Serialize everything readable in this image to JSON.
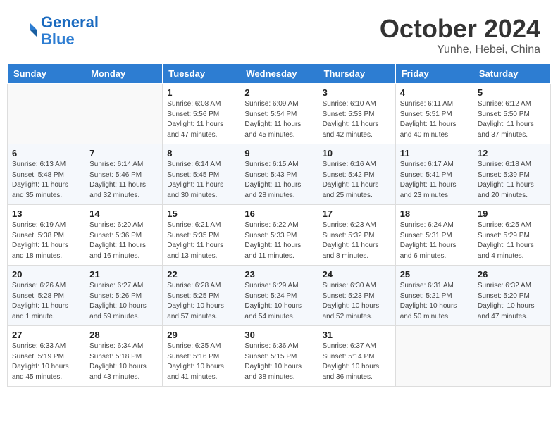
{
  "header": {
    "logo_line1": "General",
    "logo_line2": "Blue",
    "month": "October 2024",
    "location": "Yunhe, Hebei, China"
  },
  "weekdays": [
    "Sunday",
    "Monday",
    "Tuesday",
    "Wednesday",
    "Thursday",
    "Friday",
    "Saturday"
  ],
  "weeks": [
    [
      {
        "day": "",
        "info": ""
      },
      {
        "day": "",
        "info": ""
      },
      {
        "day": "1",
        "info": "Sunrise: 6:08 AM\nSunset: 5:56 PM\nDaylight: 11 hours and 47 minutes."
      },
      {
        "day": "2",
        "info": "Sunrise: 6:09 AM\nSunset: 5:54 PM\nDaylight: 11 hours and 45 minutes."
      },
      {
        "day": "3",
        "info": "Sunrise: 6:10 AM\nSunset: 5:53 PM\nDaylight: 11 hours and 42 minutes."
      },
      {
        "day": "4",
        "info": "Sunrise: 6:11 AM\nSunset: 5:51 PM\nDaylight: 11 hours and 40 minutes."
      },
      {
        "day": "5",
        "info": "Sunrise: 6:12 AM\nSunset: 5:50 PM\nDaylight: 11 hours and 37 minutes."
      }
    ],
    [
      {
        "day": "6",
        "info": "Sunrise: 6:13 AM\nSunset: 5:48 PM\nDaylight: 11 hours and 35 minutes."
      },
      {
        "day": "7",
        "info": "Sunrise: 6:14 AM\nSunset: 5:46 PM\nDaylight: 11 hours and 32 minutes."
      },
      {
        "day": "8",
        "info": "Sunrise: 6:14 AM\nSunset: 5:45 PM\nDaylight: 11 hours and 30 minutes."
      },
      {
        "day": "9",
        "info": "Sunrise: 6:15 AM\nSunset: 5:43 PM\nDaylight: 11 hours and 28 minutes."
      },
      {
        "day": "10",
        "info": "Sunrise: 6:16 AM\nSunset: 5:42 PM\nDaylight: 11 hours and 25 minutes."
      },
      {
        "day": "11",
        "info": "Sunrise: 6:17 AM\nSunset: 5:41 PM\nDaylight: 11 hours and 23 minutes."
      },
      {
        "day": "12",
        "info": "Sunrise: 6:18 AM\nSunset: 5:39 PM\nDaylight: 11 hours and 20 minutes."
      }
    ],
    [
      {
        "day": "13",
        "info": "Sunrise: 6:19 AM\nSunset: 5:38 PM\nDaylight: 11 hours and 18 minutes."
      },
      {
        "day": "14",
        "info": "Sunrise: 6:20 AM\nSunset: 5:36 PM\nDaylight: 11 hours and 16 minutes."
      },
      {
        "day": "15",
        "info": "Sunrise: 6:21 AM\nSunset: 5:35 PM\nDaylight: 11 hours and 13 minutes."
      },
      {
        "day": "16",
        "info": "Sunrise: 6:22 AM\nSunset: 5:33 PM\nDaylight: 11 hours and 11 minutes."
      },
      {
        "day": "17",
        "info": "Sunrise: 6:23 AM\nSunset: 5:32 PM\nDaylight: 11 hours and 8 minutes."
      },
      {
        "day": "18",
        "info": "Sunrise: 6:24 AM\nSunset: 5:31 PM\nDaylight: 11 hours and 6 minutes."
      },
      {
        "day": "19",
        "info": "Sunrise: 6:25 AM\nSunset: 5:29 PM\nDaylight: 11 hours and 4 minutes."
      }
    ],
    [
      {
        "day": "20",
        "info": "Sunrise: 6:26 AM\nSunset: 5:28 PM\nDaylight: 11 hours and 1 minute."
      },
      {
        "day": "21",
        "info": "Sunrise: 6:27 AM\nSunset: 5:26 PM\nDaylight: 10 hours and 59 minutes."
      },
      {
        "day": "22",
        "info": "Sunrise: 6:28 AM\nSunset: 5:25 PM\nDaylight: 10 hours and 57 minutes."
      },
      {
        "day": "23",
        "info": "Sunrise: 6:29 AM\nSunset: 5:24 PM\nDaylight: 10 hours and 54 minutes."
      },
      {
        "day": "24",
        "info": "Sunrise: 6:30 AM\nSunset: 5:23 PM\nDaylight: 10 hours and 52 minutes."
      },
      {
        "day": "25",
        "info": "Sunrise: 6:31 AM\nSunset: 5:21 PM\nDaylight: 10 hours and 50 minutes."
      },
      {
        "day": "26",
        "info": "Sunrise: 6:32 AM\nSunset: 5:20 PM\nDaylight: 10 hours and 47 minutes."
      }
    ],
    [
      {
        "day": "27",
        "info": "Sunrise: 6:33 AM\nSunset: 5:19 PM\nDaylight: 10 hours and 45 minutes."
      },
      {
        "day": "28",
        "info": "Sunrise: 6:34 AM\nSunset: 5:18 PM\nDaylight: 10 hours and 43 minutes."
      },
      {
        "day": "29",
        "info": "Sunrise: 6:35 AM\nSunset: 5:16 PM\nDaylight: 10 hours and 41 minutes."
      },
      {
        "day": "30",
        "info": "Sunrise: 6:36 AM\nSunset: 5:15 PM\nDaylight: 10 hours and 38 minutes."
      },
      {
        "day": "31",
        "info": "Sunrise: 6:37 AM\nSunset: 5:14 PM\nDaylight: 10 hours and 36 minutes."
      },
      {
        "day": "",
        "info": ""
      },
      {
        "day": "",
        "info": ""
      }
    ]
  ]
}
